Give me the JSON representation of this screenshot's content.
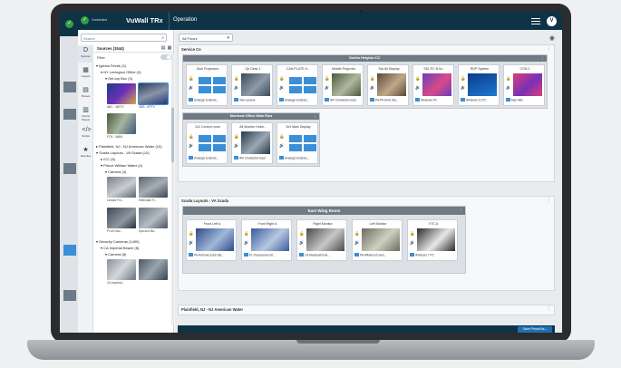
{
  "app": {
    "status": "Connected",
    "brand": "VuWall TRx",
    "section": "Operation",
    "user_initial": "V"
  },
  "bg_app": {
    "check": "✓",
    "avatar": "V"
  },
  "search": {
    "placeholder": "Search"
  },
  "rail": [
    {
      "label": "Sources",
      "icon": "sources-icon",
      "glyph": "D"
    },
    {
      "label": "Layouts",
      "icon": "layouts-icon",
      "glyph": "▦"
    },
    {
      "label": "Presets",
      "icon": "presets-icon",
      "glyph": "▤"
    },
    {
      "label": "Control Panels",
      "icon": "control-panels-icon",
      "glyph": "▥"
    },
    {
      "label": "Scripts",
      "icon": "scripts-icon",
      "glyph": "</>"
    },
    {
      "label": "Favorites",
      "icon": "favorites-icon",
      "glyph": "★"
    }
  ],
  "tree": {
    "header": "Sources (1544)",
    "filter": "Filter",
    "nodes": [
      "Iglesia Feeds (3)",
      "NY Lexington Office (3)",
      "Set-top Box (3)",
      "Plainfield, NJ - NJ American Water (10)",
      "Scada Layouts - VA Scada (10)",
      "ICC (6)",
      "Prince William Water (4)",
      "Camera (4)",
      "Security Cameras (1499)",
      "CA Imperial Beach (8)",
      "Camera (8)"
    ],
    "thumbs_a": [
      "ABC - WKTV",
      "CBS - KPTV",
      "FOX - WAM"
    ],
    "thumbs_b": [
      "Lindale Fin...",
      "Hillendale Fi...",
      "Pt A0 Disc...",
      "Spa and Ba..."
    ],
    "thumbs_c": [
      "CA Imperial..."
    ]
  },
  "floor": {
    "selected": "All Floors"
  },
  "groups": [
    {
      "title": "Service Co",
      "walls": [
        {
          "title": "Dublin Heights ICC",
          "cards": [
            {
              "title": "Dual Projectors",
              "foot": "Analogic Extends..."
            },
            {
              "title": "Op Desk 1",
              "foot": "Tele-Lecture"
            },
            {
              "title": "CAN PLATE H...",
              "foot": "Analogic Extends..."
            },
            {
              "title": "Middle Projector",
              "foot": "WV Charleston East"
            },
            {
              "title": "Top All Display",
              "foot": "PA-PA Drive Sta..."
            },
            {
              "title": "SDI-PC B Isl...",
              "foot": "Windows PC"
            },
            {
              "title": "RDP System",
              "foot": "Windows 10 PC"
            },
            {
              "title": "CON 2",
              "foot": "Mac Mini"
            }
          ]
        },
        {
          "title": "Montreal Office Main Row",
          "cards": [
            {
              "title": "2x2 Control room",
              "foot": "Analogic Extends..."
            },
            {
              "title": "All Monitor Hubb...",
              "foot": "WV Charleston East"
            },
            {
              "title": "3x3 Main Display",
              "foot": "Analogic Extends..."
            }
          ]
        }
      ]
    },
    {
      "title": "Scada Layouts - VA Scada",
      "walls": [
        {
          "title": "East Wing Room",
          "cards": [
            {
              "title": "Front Left A",
              "foot": "PA-Ardmore East Sta..."
            },
            {
              "title": "Front Right A",
              "foot": "PL Pensacola Exit..."
            },
            {
              "title": "Right Monitor",
              "foot": "CA Meadowbrook..."
            },
            {
              "title": "Left Monitor",
              "foot": "PA Wildwood Gard..."
            },
            {
              "title": "VTC A",
              "foot": "Windows 7 PC"
            }
          ]
        }
      ]
    },
    {
      "title": "Plainfield, NJ - NJ American Water",
      "walls": []
    }
  ],
  "save_button": "Save Preset As...",
  "colors": {
    "brand": "#0e3347",
    "accent": "#1f6fb2",
    "status": "#2ea043"
  }
}
